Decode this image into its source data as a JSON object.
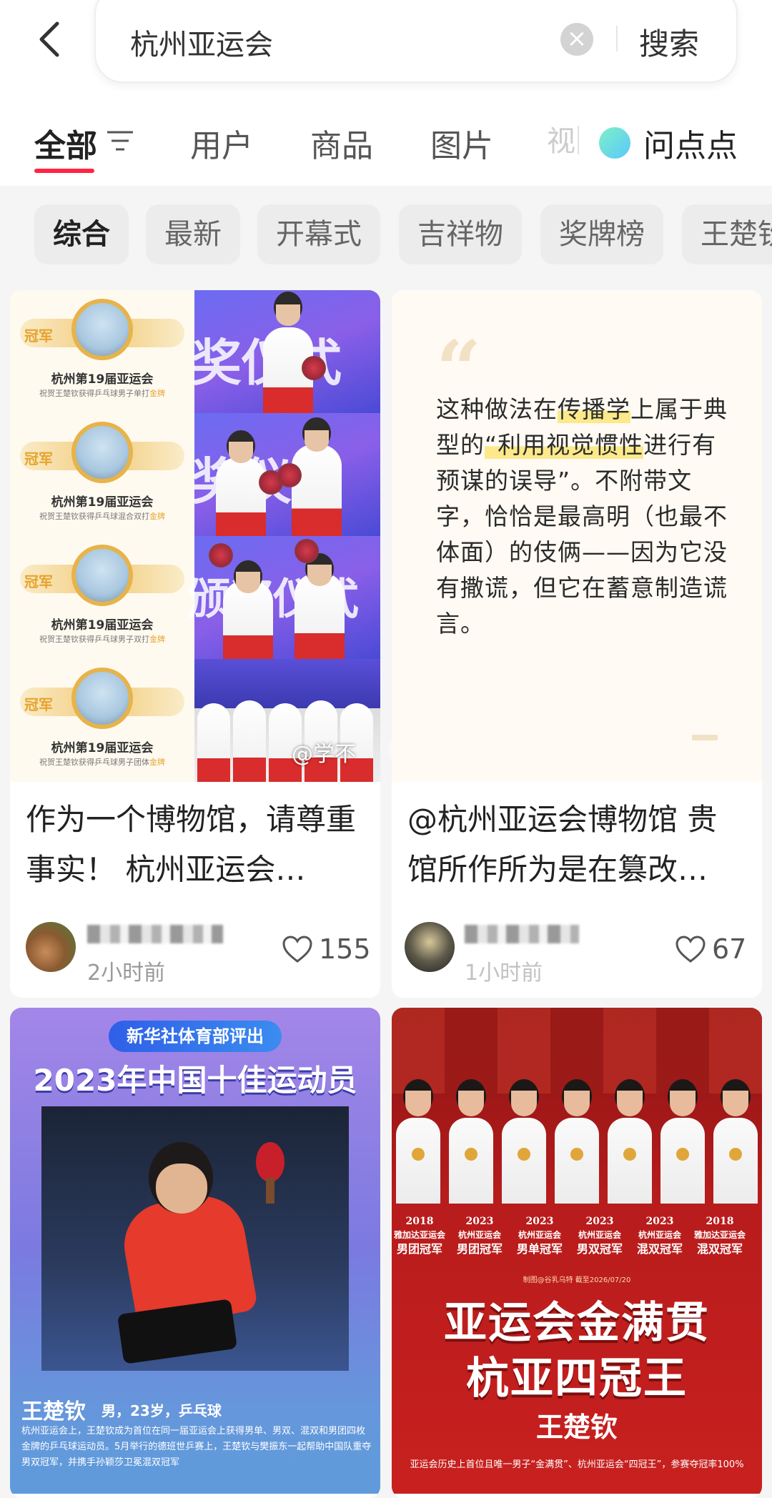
{
  "search": {
    "query": "杭州亚运会",
    "clear_symbol": "×",
    "search_label": "搜索"
  },
  "tabs": {
    "items": [
      "全部",
      "用户",
      "商品",
      "图片"
    ],
    "faded": "视",
    "qa_label": "问点点"
  },
  "chips": [
    "综合",
    "最新",
    "开幕式",
    "吉祥物",
    "奖牌榜",
    "王楚钦"
  ],
  "cards": [
    {
      "title": "作为一个博物馆，请尊重事实！ 杭州亚运会…",
      "time": "2小时前",
      "likes": "155",
      "image": {
        "medals": [
          {
            "badge": "冠军",
            "title": "杭州第19届亚运会",
            "sub": "祝贺王楚钦获得乒乓球男子单打",
            "sub_hl": "金牌"
          },
          {
            "badge": "冠军",
            "title": "杭州第19届亚运会",
            "sub": "祝贺王楚钦获得乒乓球混合双打",
            "sub_hl": "金牌"
          },
          {
            "badge": "冠军",
            "title": "杭州第19届亚运会",
            "sub": "祝贺王楚钦获得乒乓球男子双打",
            "sub_hl": "金牌"
          },
          {
            "badge": "冠军",
            "title": "杭州第19届亚运会",
            "sub": "祝贺王楚钦获得乒乓球男子团体",
            "sub_hl": "金牌"
          }
        ],
        "ceremony_texts": [
          "奖仪式",
          "奖仪式",
          "颁奖仪式"
        ],
        "watermark": "@学不"
      }
    },
    {
      "title": "@杭州亚运会博物馆 贵馆所作所为是在篡改…",
      "time": "1小时前",
      "likes": "67",
      "image": {
        "quote_mark": "“",
        "quote_parts": [
          {
            "t": "这种做法在",
            "hl": false
          },
          {
            "t": "传播学",
            "hl": true
          },
          {
            "t": "上属于典型的",
            "hl": false
          },
          {
            "t": "“利用视觉惯性",
            "hl": true
          },
          {
            "t": "进行有预谋的误导”。不附带文字，恰恰是最高明（也最不体面）的伎俩——因为它没有撒谎，但它在蓄意制造谎言。",
            "hl": false
          }
        ]
      }
    },
    {
      "image": {
        "pill": "新华社体育部评出",
        "title": "2023年中国十佳运动员",
        "name": "王楚钦",
        "meta": "男，23岁，乒乓球",
        "desc": "杭州亚运会上，王楚钦成为首位在同一届亚运会上获得男单、男双、混双和男团四枚金牌的乒乓球运动员。5月举行的德班世乒赛上，王楚钦与樊振东一起帮助中国队重夺男双冠军，并携手孙颖莎卫冕混双冠军"
      }
    },
    {
      "image": {
        "captions": [
          {
            "year": "2018",
            "sub": "雅加达亚运会",
            "event": "男团冠军"
          },
          {
            "year": "2023",
            "sub": "杭州亚运会",
            "event": "男团冠军"
          },
          {
            "year": "2023",
            "sub": "杭州亚运会",
            "event": "男单冠军"
          },
          {
            "year": "2023",
            "sub": "杭州亚运会",
            "event": "男双冠军"
          },
          {
            "year": "2023",
            "sub": "杭州亚运会",
            "event": "混双冠军"
          },
          {
            "year": "2018",
            "sub": "雅加达亚运会",
            "event": "混双冠军"
          }
        ],
        "source": "制图@谷乳乌特 截至2026/07/20",
        "big1": "亚运会金满贯",
        "big2": "杭亚四冠王",
        "name": "王楚钦",
        "foot": "亚运会历史上首位且唯一男子“金满贯”、杭州亚运会“四冠王”，参赛夺冠率100%"
      }
    }
  ]
}
